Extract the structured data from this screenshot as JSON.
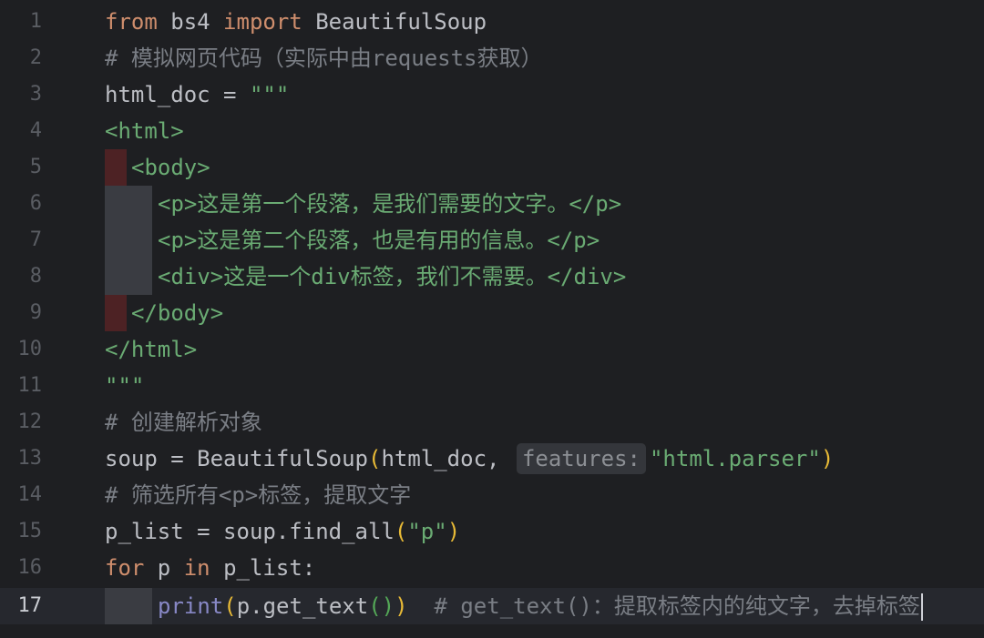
{
  "editor": {
    "line_numbers": [
      "1",
      "2",
      "3",
      "4",
      "5",
      "6",
      "7",
      "8",
      "9",
      "10",
      "11",
      "12",
      "13",
      "14",
      "15",
      "16",
      "17"
    ],
    "l1": {
      "from": "from",
      "mod": " bs4 ",
      "import": "import",
      "name": " BeautifulSoup"
    },
    "l2": {
      "comment": "# 模拟网页代码（实际中由requests获取）"
    },
    "l3": {
      "var": "html_doc = ",
      "str": "\"\"\""
    },
    "l4": {
      "str": "<html>"
    },
    "l5": {
      "str": "<body>"
    },
    "l6": {
      "str": "<p>这是第一个段落，是我们需要的文字。</p>"
    },
    "l7": {
      "str": "<p>这是第二个段落，也是有用的信息。</p>"
    },
    "l8": {
      "str": "<div>这是一个div标签，我们不需要。</div>"
    },
    "l9": {
      "str": "</body>"
    },
    "l10": {
      "str": "</html>"
    },
    "l11": {
      "str": "\"\"\""
    },
    "l12": {
      "comment": "# 创建解析对象"
    },
    "l13": {
      "a": "soup = BeautifulSoup",
      "p1": "(",
      "b": "html_doc, ",
      "hint": "features:",
      "str": "\"html.parser\"",
      "p2": ")"
    },
    "l14": {
      "comment": "# 筛选所有<p>标签，提取文字"
    },
    "l15": {
      "a": "p_list = soup.find_all",
      "p1": "(",
      "str": "\"p\"",
      "p2": ")"
    },
    "l16": {
      "for": "for",
      "mid": " p ",
      "in": "in",
      "rest": " p_list:"
    },
    "l17": {
      "print": "print",
      "p1": "(",
      "a": "p.get_text",
      "p2": "()",
      "p3": ")",
      "comment": "  # get_text()：提取标签内的纯文字，去掉标签"
    }
  },
  "colors": {
    "background": "#1e1f22",
    "keyword": "#cf8e6d",
    "string": "#6aab73",
    "comment": "#7a7e85",
    "builtin": "#8888c6",
    "bracket_yellow": "#e8ba36"
  }
}
